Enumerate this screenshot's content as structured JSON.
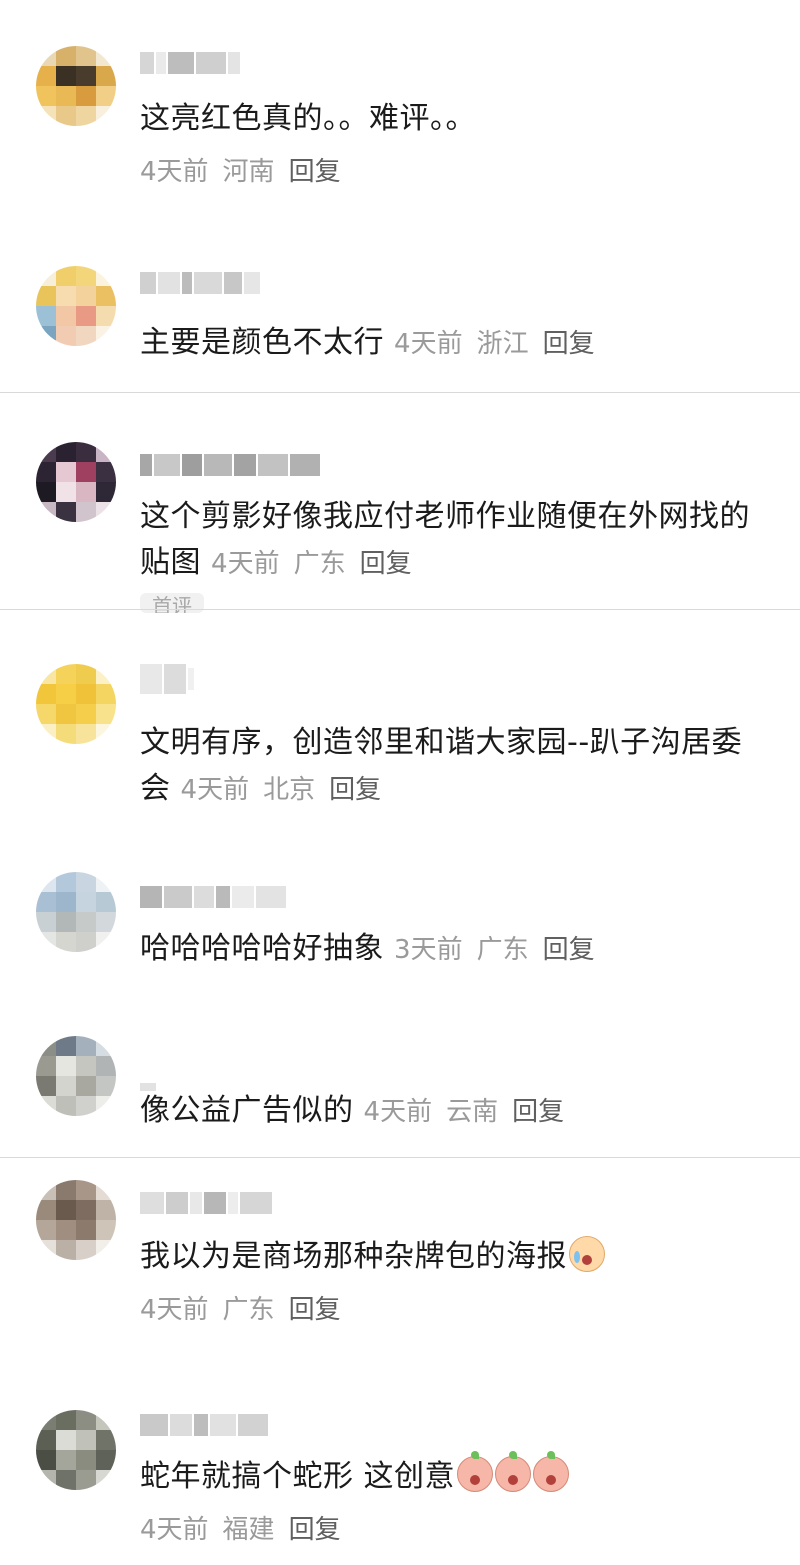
{
  "comments": [
    {
      "text": "这亮红色真的。。难评。。",
      "time": "4天前",
      "location": "河南",
      "reply": "回复"
    },
    {
      "text": "主要是颜色不太行",
      "time": "4天前",
      "location": "浙江",
      "reply": "回复"
    },
    {
      "text": "这个剪影好像我应付老师作业随便在外网找的贴图",
      "time": "4天前",
      "location": "广东",
      "reply": "回复",
      "tag": "首评"
    },
    {
      "text": "文明有序，创造邻里和谐大家园--趴子沟居委会",
      "time": "4天前",
      "location": "北京",
      "reply": "回复"
    },
    {
      "text": "哈哈哈哈哈好抽象",
      "time": "3天前",
      "location": "广东",
      "reply": "回复"
    },
    {
      "text": "像公益广告似的",
      "time": "4天前",
      "location": "云南",
      "reply": "回复"
    },
    {
      "text": "我以为是商场那种杂牌包的海报",
      "time": "4天前",
      "location": "广东",
      "reply": "回复",
      "emoji": "crying-laughing-emoji"
    },
    {
      "text": "蛇年就搞个蛇形 这创意",
      "time": "4天前",
      "location": "福建",
      "reply": "回复",
      "emoji": "peach-shocked-emoji"
    }
  ]
}
